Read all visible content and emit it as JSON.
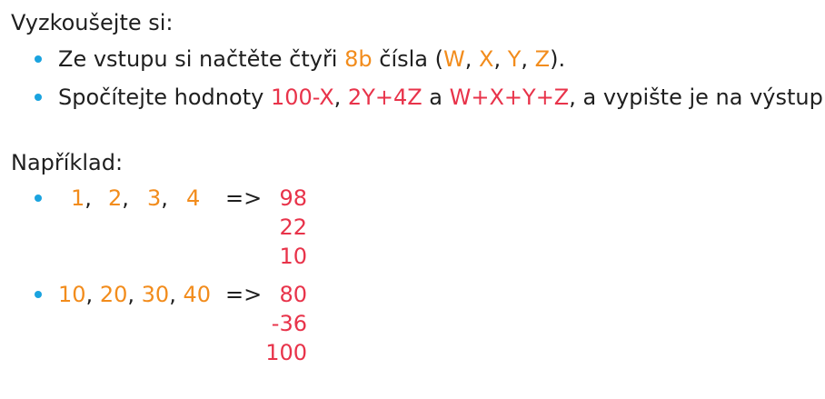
{
  "heading": "Vyzkoušejte si:",
  "task1": {
    "prefix": "Ze vstupu si načtěte čtyři ",
    "bits": "8b",
    "middle": " čísla (",
    "w": "W",
    "x": "X",
    "y": "Y",
    "z": "Z",
    "sep": ", ",
    "suffix": ")."
  },
  "task2": {
    "prefix": "Spočítejte hodnoty ",
    "expr1": "100-X",
    "sep": ", ",
    "expr2": "2Y+4Z",
    "and": " a ",
    "expr3": "W+X+Y+Z",
    "suffix": ", a vypište je na výstup."
  },
  "example_heading": "Například:",
  "examples": [
    {
      "inputs": [
        "1",
        "2",
        "3",
        "4"
      ],
      "arrow": "=>",
      "outputs": [
        "98",
        "22",
        "10"
      ]
    },
    {
      "inputs": [
        "10",
        "20",
        "30",
        "40"
      ],
      "arrow": "=>",
      "outputs": [
        "80",
        "-36",
        "100"
      ]
    }
  ],
  "comma": ",",
  "colors": {
    "bullet": "#1aa3df",
    "orange": "#f28c1c",
    "red": "#e8334a",
    "text": "#1f1f1f"
  }
}
